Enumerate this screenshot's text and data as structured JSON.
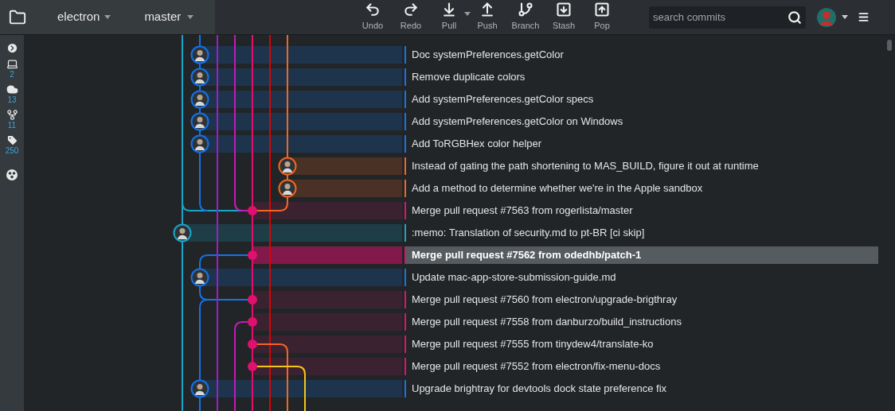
{
  "toolbar": {
    "repository": "electron",
    "branch": "master",
    "actions": [
      {
        "kind": "undo",
        "label": "Undo"
      },
      {
        "kind": "redo",
        "label": "Redo"
      },
      {
        "kind": "pull",
        "label": "Pull"
      },
      {
        "kind": "push",
        "label": "Push"
      },
      {
        "kind": "branch",
        "label": "Branch"
      },
      {
        "kind": "stash",
        "label": "Stash"
      },
      {
        "kind": "pop",
        "label": "Pop"
      }
    ],
    "search": {
      "placeholder": "search commits"
    }
  },
  "sidebar": {
    "items": [
      {
        "kind": "expand"
      },
      {
        "kind": "local",
        "count": "2"
      },
      {
        "kind": "remote",
        "count": "13"
      },
      {
        "kind": "pull_requests",
        "count": "11"
      },
      {
        "kind": "tags",
        "count": "250"
      },
      {
        "kind": "submodules"
      }
    ]
  },
  "commits": [
    {
      "kind": "commit",
      "message": "Doc systemPreferences.getColor",
      "color": "#1273eb",
      "selected": false
    },
    {
      "kind": "commit",
      "message": "Remove duplicate colors",
      "color": "#1273eb",
      "selected": false
    },
    {
      "kind": "commit",
      "message": "Add systemPreferences.getColor specs",
      "color": "#1273eb",
      "selected": false
    },
    {
      "kind": "commit",
      "message": "Add systemPreferences.getColor on Windows",
      "color": "#1273eb",
      "selected": false
    },
    {
      "kind": "commit",
      "message": "Add ToRGBHex color helper",
      "color": "#1273eb",
      "selected": false
    },
    {
      "kind": "commit",
      "message": "Instead of gating the path shortening to MAS_BUILD, figure it out at runtime",
      "color": "#f26522",
      "selected": false
    },
    {
      "kind": "commit",
      "message": "Add a method to determine whether we're in the Apple sandbox",
      "color": "#f26522",
      "selected": false
    },
    {
      "kind": "merge",
      "message": "Merge pull request #7563 from rogerlista/master",
      "color": "#e0106e",
      "selected": false
    },
    {
      "kind": "commit",
      "message": ":memo: Translation of security.md to pt-BR [ci skip]",
      "color": "#17a5c9",
      "selected": false
    },
    {
      "kind": "merge",
      "message": "Merge pull request #7562 from odedhb/patch-1",
      "color": "#e0106e",
      "selected": true
    },
    {
      "kind": "commit",
      "message": "Update mac-app-store-submission-guide.md",
      "color": "#1273eb",
      "selected": false
    },
    {
      "kind": "merge",
      "message": "Merge pull request #7560 from electron/upgrade-brigthray",
      "color": "#e0106e",
      "selected": false
    },
    {
      "kind": "merge",
      "message": "Merge pull request #7558 from danburzo/build_instructions",
      "color": "#e0106e",
      "selected": false
    },
    {
      "kind": "merge",
      "message": "Merge pull request #7555 from tinydew4/translate-ko",
      "color": "#e0106e",
      "selected": false
    },
    {
      "kind": "merge",
      "message": "Merge pull request #7552 from electron/fix-menu-docs",
      "color": "#e0106e",
      "selected": false
    },
    {
      "kind": "commit",
      "message": "Upgrade brightray for devtools dock state preference fix",
      "color": "#1273eb",
      "selected": false
    }
  ]
}
